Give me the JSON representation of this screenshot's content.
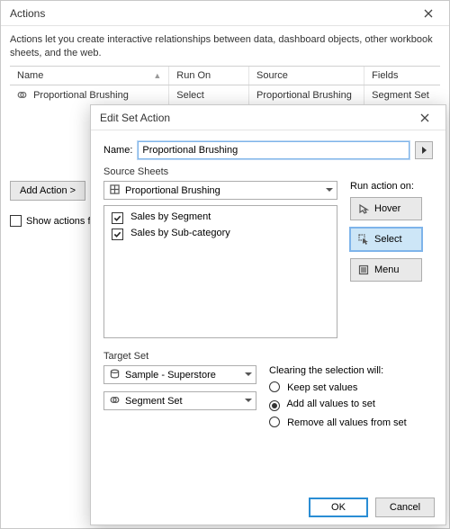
{
  "mainWindow": {
    "title": "Actions",
    "description": "Actions let you create interactive relationships between data, dashboard objects, other workbook sheets, and the web.",
    "columns": {
      "name": "Name",
      "runOn": "Run On",
      "source": "Source",
      "fields": "Fields"
    },
    "row": {
      "name": "Proportional Brushing",
      "runOn": "Select",
      "source": "Proportional Brushing",
      "fields": "Segment Set"
    },
    "addActionBtn": "Add Action >",
    "showActionsLabel": "Show actions for"
  },
  "dialog": {
    "title": "Edit Set Action",
    "nameLabel": "Name:",
    "nameValue": "Proportional Brushing",
    "sourceSheetsLabel": "Source Sheets",
    "sourceDashboard": "Proportional Brushing",
    "sourceSheets": [
      {
        "label": "Sales by Segment",
        "checked": true
      },
      {
        "label": "Sales by Sub-category",
        "checked": true
      }
    ],
    "runActionLabel": "Run action on:",
    "runOptions": {
      "hover": "Hover",
      "select": "Select",
      "menu": "Menu"
    },
    "runSelected": "select",
    "targetSetLabel": "Target Set",
    "targetDataSource": "Sample - Superstore",
    "targetSet": "Segment Set",
    "clearingLabel": "Clearing the selection will:",
    "clearOptions": {
      "keep": "Keep set values",
      "add": "Add all values to set",
      "remove": "Remove all values from set"
    },
    "clearSelected": "add",
    "okLabel": "OK",
    "cancelLabel": "Cancel"
  }
}
